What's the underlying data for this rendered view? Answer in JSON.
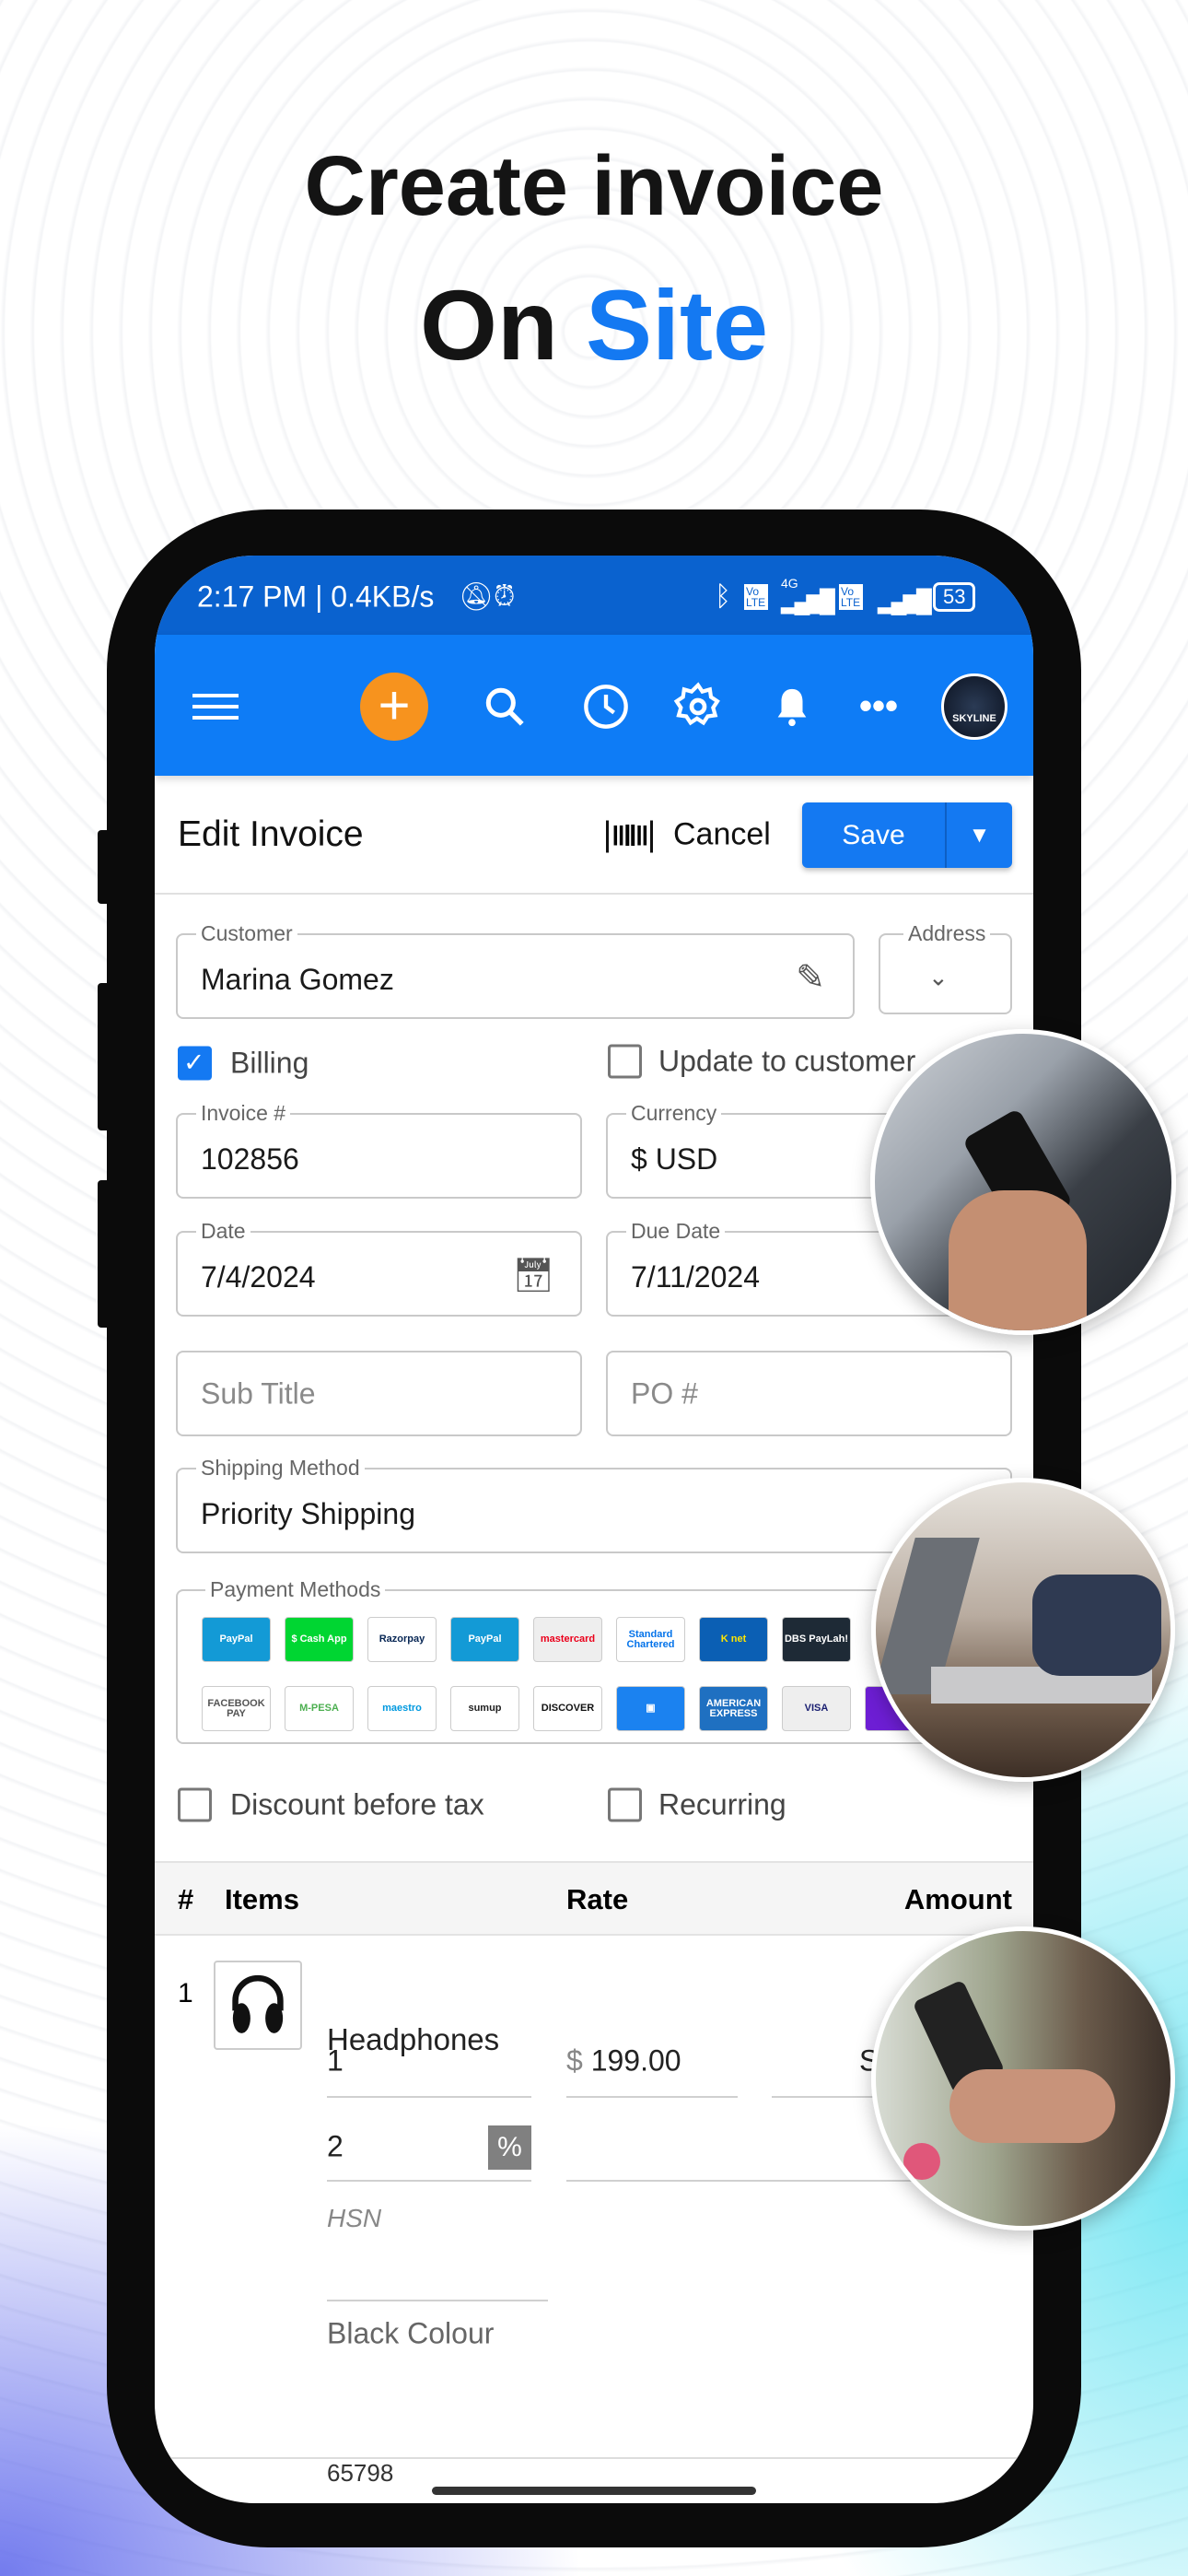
{
  "headline": {
    "line1": "Create invoice",
    "line2_a": "On",
    "line2_b": "Site",
    "accent": "#1479f2"
  },
  "status_bar": {
    "time": "2:17 PM | 0.4KB/s",
    "network": "4G",
    "volte": "Vo LTE",
    "battery": "53"
  },
  "app_bar": {
    "color": "#0e7cf6",
    "icons": [
      "menu-icon",
      "add-icon",
      "search-icon",
      "history-icon",
      "settings-icon",
      "bell-icon",
      "more-icon"
    ],
    "avatar_text": "SKYLINE"
  },
  "header": {
    "title": "Edit Invoice",
    "cancel": "Cancel",
    "save": "Save"
  },
  "form": {
    "customer": {
      "label": "Customer",
      "value": "Marina Gomez"
    },
    "address": {
      "label": "Address"
    },
    "billing": {
      "label": "Billing",
      "checked": true
    },
    "update_customer": {
      "label": "Update to customer",
      "checked": false
    },
    "invoice_no": {
      "label": "Invoice #",
      "value": "102856"
    },
    "currency": {
      "label": "Currency",
      "value": "$ USD"
    },
    "date": {
      "label": "Date",
      "value": "7/4/2024"
    },
    "due_date": {
      "label": "Due Date",
      "value": "7/11/2024"
    },
    "sub_title": {
      "placeholder": "Sub Title"
    },
    "po": {
      "placeholder": "PO #"
    },
    "shipping": {
      "label": "Shipping Method",
      "value": "Priority Shipping"
    },
    "payment_label": "Payment Methods",
    "payment_methods": [
      {
        "name": "PayPal",
        "bg": "#139ad6",
        "fg": "#fff"
      },
      {
        "name": "$ Cash App",
        "bg": "#00d632",
        "fg": "#fff"
      },
      {
        "name": "Razorpay",
        "bg": "#fff",
        "fg": "#072654"
      },
      {
        "name": "PayPal",
        "bg": "#139ad6",
        "fg": "#fff"
      },
      {
        "name": "mastercard",
        "bg": "#eee",
        "fg": "#eb001b"
      },
      {
        "name": "Standard Chartered",
        "bg": "#fff",
        "fg": "#0473ea"
      },
      {
        "name": "K net",
        "bg": "#0b5fb4",
        "fg": "#ffe500"
      },
      {
        "name": "DBS PayLah!",
        "bg": "#1e2a36",
        "fg": "#fff"
      },
      {
        "name": "FACEBOOK PAY",
        "bg": "#fff",
        "fg": "#555"
      },
      {
        "name": "M-PESA",
        "bg": "#fff",
        "fg": "#4caf50"
      },
      {
        "name": "maestro",
        "bg": "#fff",
        "fg": "#0099df"
      },
      {
        "name": "sumup",
        "bg": "#fff",
        "fg": "#222"
      },
      {
        "name": "DISCOVER",
        "bg": "#fff",
        "fg": "#111"
      },
      {
        "name": "▣",
        "bg": "#1b82f0",
        "fg": "#fff"
      },
      {
        "name": "AMERICAN EXPRESS",
        "bg": "#1f70c1",
        "fg": "#fff"
      },
      {
        "name": "VISA",
        "bg": "#eee",
        "fg": "#1a1f71"
      },
      {
        "name": "Z",
        "bg": "#6d1ed4",
        "fg": "#fff"
      }
    ],
    "discount_before_tax": {
      "label": "Discount before tax",
      "checked": false
    },
    "recurring": {
      "label": "Recurring",
      "checked": false
    }
  },
  "items_table": {
    "columns": [
      "#",
      "Items",
      "Rate",
      "Amount"
    ],
    "rows": [
      {
        "index": "1",
        "name": "Headphones",
        "qty": "1",
        "rate_symbol": "$",
        "rate": "199.00",
        "amount_partial": "S",
        "discount": "2",
        "discount_unit": "%",
        "hsn_placeholder": "HSN",
        "description": "Black Colour",
        "next_partial": "65798"
      }
    ]
  }
}
